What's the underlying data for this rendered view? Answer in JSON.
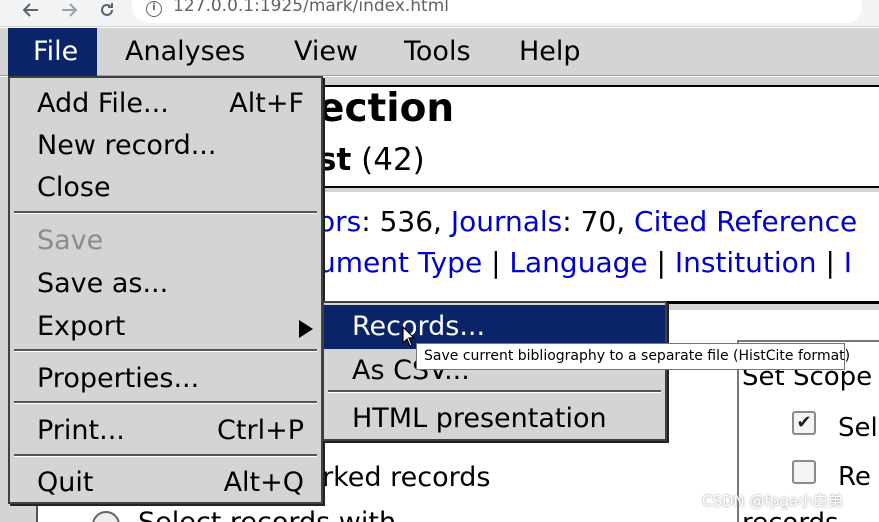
{
  "browser": {
    "url": "127.0.0.1:1925/mark/index.html",
    "back_icon": "arrow-left-icon",
    "forward_icon": "arrow-right-icon",
    "reload_icon": "reload-icon",
    "info_icon": "info-icon"
  },
  "menubar": {
    "items": [
      "File",
      "Analyses",
      "View",
      "Tools",
      "Help"
    ],
    "active": "File",
    "active_color": "#0a246a"
  },
  "page": {
    "title": "ection",
    "subtitle_bold": "st",
    "subtitle_count": "(42)",
    "stats": {
      "authors_label": "ors",
      "authors_value": ": 536, ",
      "journals_label": "Journals",
      "journals_value": ": 70, ",
      "cited_label": "Cited Reference"
    },
    "links": {
      "document_type": "ument Type",
      "sep1": " | ",
      "language": "Language",
      "sep2": " | ",
      "institution": "Institution",
      "sep3": " | ",
      "more": "I"
    },
    "set_scope": "Set Scope",
    "scope_opt1": "Sel",
    "scope_opt2": "Re",
    "marked_records": "rked records",
    "partial_bottom_right": "records",
    "partial_bottom_left": "Select records with"
  },
  "file_menu": {
    "items": [
      {
        "label": "Add File...",
        "shortcut": "Alt+F",
        "disabled": false
      },
      {
        "label": "New record...",
        "shortcut": "",
        "disabled": false
      },
      {
        "label": "Close",
        "shortcut": "",
        "disabled": false
      },
      {
        "label": "Save",
        "shortcut": "",
        "disabled": true
      },
      {
        "label": "Save as...",
        "shortcut": "",
        "disabled": false
      },
      {
        "label": "Export",
        "shortcut": "",
        "disabled": false,
        "submenu": true
      },
      {
        "label": "Properties...",
        "shortcut": "",
        "disabled": false
      },
      {
        "label": "Print...",
        "shortcut": "Ctrl+P",
        "disabled": false
      },
      {
        "label": "Quit",
        "shortcut": "Alt+Q",
        "disabled": false
      }
    ]
  },
  "export_submenu": {
    "items": [
      "Records...",
      "As CSV...",
      "HTML presentation"
    ],
    "highlighted": "Records..."
  },
  "tooltip": "Save current bibliography to a separate file (HistCite format)",
  "watermark": "CSDN @fpga小白弟"
}
